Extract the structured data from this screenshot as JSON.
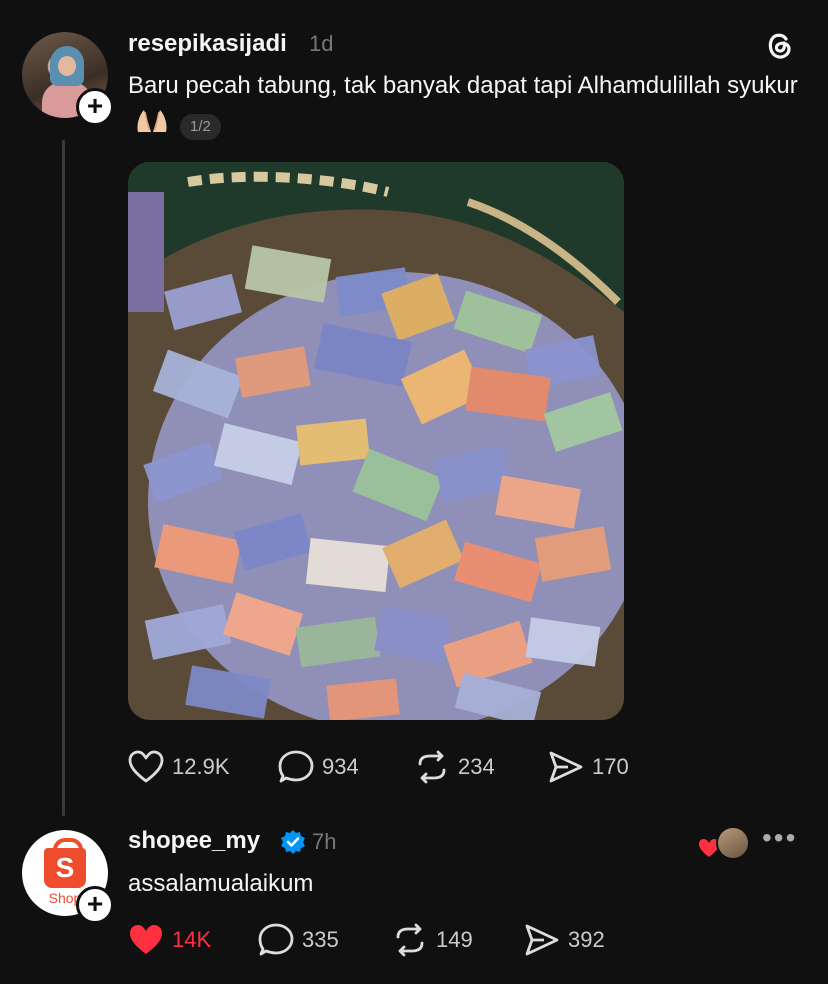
{
  "posts": [
    {
      "username": "resepikasijadi",
      "time": "1d",
      "text": "Baru pecah tabung, tak banyak dapat tapi Alhamdulillah syukur",
      "page_indicator": "1/2",
      "media_icon": "money-pile-photo",
      "likes": "12.9K",
      "comments": "934",
      "reposts": "234",
      "shares": "170",
      "liked": false
    },
    {
      "username": "shopee_my",
      "time": "7h",
      "verified": true,
      "text": "assalamualaikum",
      "likes": "14K",
      "comments": "335",
      "reposts": "149",
      "shares": "392",
      "liked": true,
      "avatar_word": "Shop",
      "avatar_letter": "S"
    }
  ],
  "icons": {
    "threads": "threads-logo-icon",
    "more": "more-dots-icon",
    "plus": "follow-plus-icon"
  },
  "colors": {
    "background": "#101010",
    "like_active": "#ff3040",
    "verified": "#0095f6",
    "shopee": "#ee4d2d"
  }
}
